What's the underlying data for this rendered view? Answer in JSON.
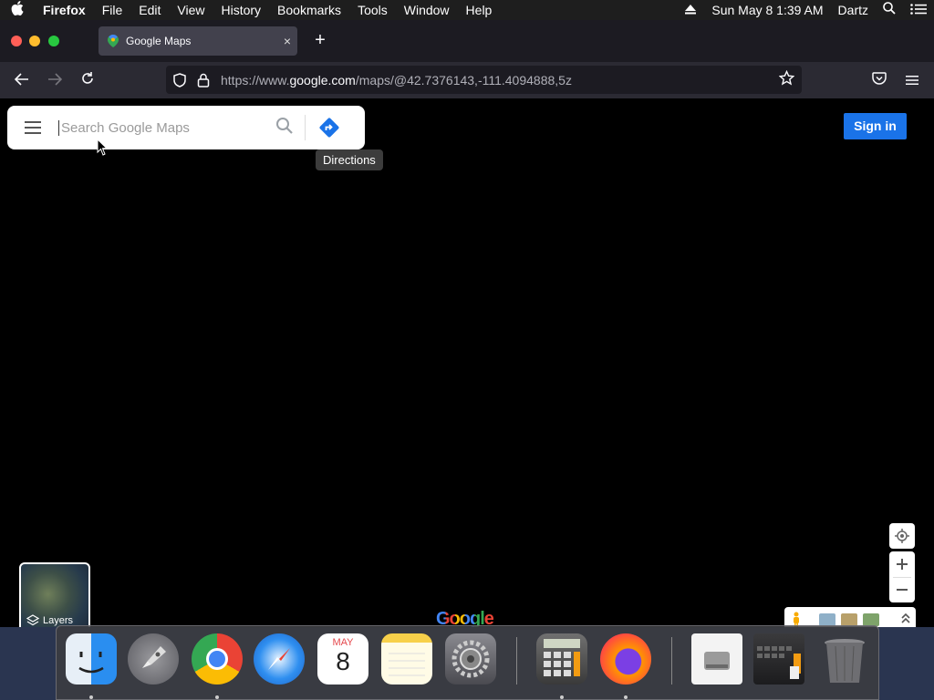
{
  "menubar": {
    "apple": "",
    "app": "Firefox",
    "items": [
      "File",
      "Edit",
      "View",
      "History",
      "Bookmarks",
      "Tools",
      "Window",
      "Help"
    ],
    "datetime": "Sun May 8  1:39 AM",
    "user": "Dartz"
  },
  "tab": {
    "title": "Google Maps",
    "close": "×"
  },
  "newtab_label": "+",
  "urlbar": {
    "prefix": "https://www.",
    "domain": "google.com",
    "path": "/maps/@42.7376143,-111.4094888,5z"
  },
  "maps": {
    "search_placeholder": "Search Google Maps",
    "directions_tooltip": "Directions",
    "signin": "Sign in",
    "layers": "Layers",
    "logo": "Google"
  },
  "calendar": {
    "month": "MAY",
    "day": "8"
  },
  "colors": {
    "signin_bg": "#1a73e8",
    "directions_icon": "#1a73e8"
  }
}
